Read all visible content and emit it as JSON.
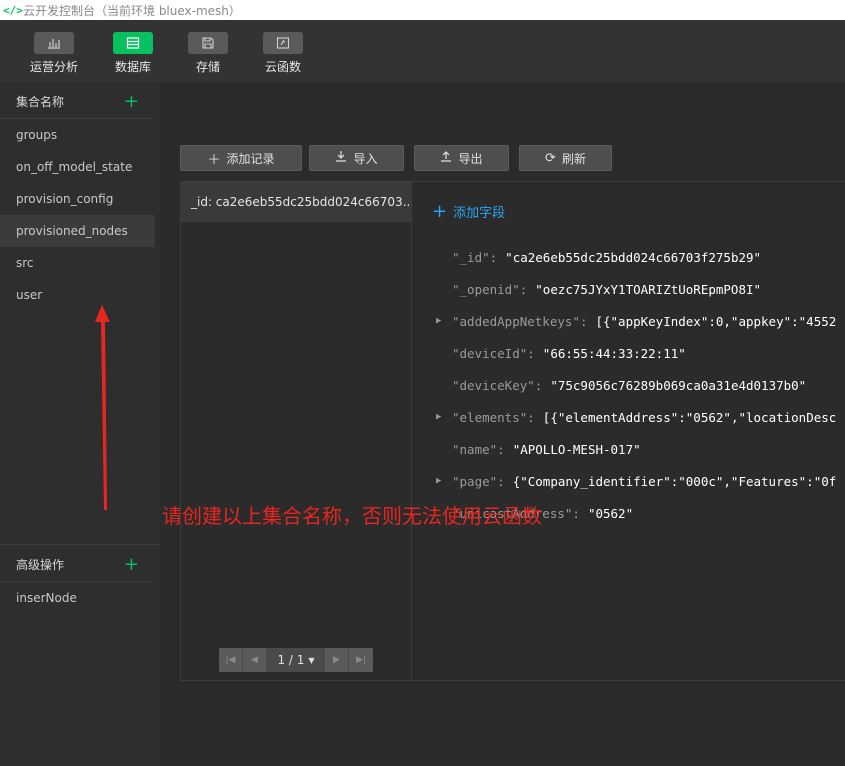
{
  "window": {
    "title": "云开发控制台（当前环境 bluex-mesh）"
  },
  "toolbar": {
    "items": [
      {
        "label": "运营分析",
        "icon": "bar-chart-icon"
      },
      {
        "label": "数据库",
        "icon": "database-icon"
      },
      {
        "label": "存储",
        "icon": "storage-icon"
      },
      {
        "label": "云函数",
        "icon": "cloud-function-icon"
      }
    ],
    "active": "数据库"
  },
  "sidebar": {
    "collections_header": "集合名称",
    "collections": [
      "groups",
      "on_off_model_state",
      "provision_config",
      "provisioned_nodes",
      "src",
      "user"
    ],
    "selected_collection": "provisioned_nodes",
    "advanced_header": "高级操作",
    "advanced_items": [
      "inserNode"
    ]
  },
  "actions": {
    "add_record": "添加记录",
    "import": "导入",
    "export": "导出",
    "refresh": "刷新"
  },
  "records": {
    "items": [
      "_id: ca2e6eb55dc25bdd024c66703..."
    ],
    "pager": "1 / 1"
  },
  "detail": {
    "add_field": "添加字段",
    "fields": [
      {
        "key": "\"_id\"",
        "value": "\"ca2e6eb55dc25bdd024c66703f275b29\"",
        "expandable": false
      },
      {
        "key": "\"_openid\"",
        "value": "\"oezc75JYxY1TOARIZtUoREpmPO8I\"",
        "expandable": false
      },
      {
        "key": "\"addedAppNetkeys\"",
        "value": "[{\"appKeyIndex\":0,\"appkey\":\"4552",
        "expandable": true
      },
      {
        "key": "\"deviceId\"",
        "value": "\"66:55:44:33:22:11\"",
        "expandable": false
      },
      {
        "key": "\"deviceKey\"",
        "value": "\"75c9056c76289b069ca0a31e4d0137b0\"",
        "expandable": false
      },
      {
        "key": "\"elements\"",
        "value": "[{\"elementAddress\":\"0562\",\"locationDesc",
        "expandable": true
      },
      {
        "key": "\"name\"",
        "value": "\"APOLLO-MESH-017\"",
        "expandable": false
      },
      {
        "key": "\"page\"",
        "value": "{\"Company_identifier\":\"000c\",\"Features\":\"0f",
        "expandable": true
      },
      {
        "key": "\"unicastAddress\"",
        "value": "\"0562\"",
        "expandable": false
      }
    ]
  },
  "annotation": {
    "text": "请创建以上集合名称，否则无法使用云函数",
    "color": "#e8261f"
  },
  "colors": {
    "accent_green": "#07c160",
    "link_blue": "#2aa4f4",
    "panel_bg": "#2b2b2b"
  }
}
